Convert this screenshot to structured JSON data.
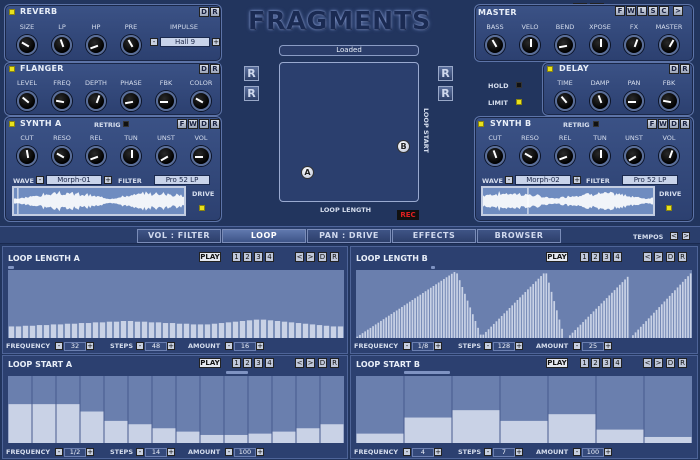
{
  "app": {
    "logo": "FRAGMENTS"
  },
  "header_buttons": {
    "d": "D",
    "r": "R",
    "f": "F",
    "w": "W",
    "l": "L",
    "s": "S",
    "c": "C",
    "next": ">"
  },
  "reverb": {
    "title": "REVERB",
    "labels": [
      "SIZE",
      "LP",
      "HP",
      "PRE",
      "IMPULSE"
    ],
    "impulse": "Hall 9"
  },
  "flanger": {
    "title": "FLANGER",
    "labels": [
      "LEVEL",
      "FREQ",
      "DEPTH",
      "PHASE",
      "FBK",
      "COLOR"
    ]
  },
  "synth_a": {
    "title": "SYNTH A",
    "retrig": "RETRIG",
    "labels": [
      "CUT",
      "RESO",
      "REL",
      "TUN",
      "UNST",
      "VOL"
    ],
    "wave_label": "WAVE",
    "wave": "Morph-01",
    "filter_label": "FILTER",
    "filter": "Pro 52 LP",
    "drive": "DRIVE"
  },
  "master": {
    "title": "MASTER",
    "labels": [
      "BASS",
      "VELO",
      "BEND",
      "XPOSE",
      "FX",
      "MASTER"
    ]
  },
  "delay": {
    "title": "DELAY",
    "labels": [
      "TIME",
      "DAMP",
      "PAN",
      "FBK"
    ]
  },
  "hold": "HOLD",
  "limit": "LIMIT",
  "synth_b": {
    "title": "SYNTH B",
    "retrig": "RETRIG",
    "labels": [
      "CUT",
      "RESO",
      "REL",
      "TUN",
      "UNST",
      "VOL"
    ],
    "wave_label": "WAVE",
    "wave": "Morph-02",
    "filter_label": "FILTER",
    "filter": "Pro 52 LP",
    "drive": "DRIVE"
  },
  "center": {
    "status": "Loaded",
    "loop_length": "LOOP LENGTH",
    "loop_start": "LOOP START",
    "ball_a": "A",
    "ball_b": "B",
    "rec": "REC"
  },
  "tabs": [
    "VOL : FILTER",
    "LOOP",
    "PAN : DRIVE",
    "EFFECTS",
    "BROWSER"
  ],
  "tempos": {
    "label": "TEMPOS",
    "prev": "<",
    "next": ">"
  },
  "loops": {
    "common": {
      "play": "PLAY",
      "nums": [
        "1",
        "2",
        "3",
        "4"
      ],
      "prev": "<",
      "next": ">",
      "d": "D",
      "r": "R",
      "freq": "FREQUENCY",
      "steps": "STEPS",
      "amount": "AMOUNT",
      "minus": "-",
      "plus": "+"
    },
    "length_a": {
      "title": "LOOP LENGTH A",
      "frequency": "32",
      "steps": "48",
      "amount": "16",
      "bars": [
        0.17,
        0.17,
        0.18,
        0.18,
        0.19,
        0.19,
        0.2,
        0.2,
        0.21,
        0.21,
        0.22,
        0.22,
        0.23,
        0.23,
        0.24,
        0.24,
        0.25,
        0.25,
        0.24,
        0.24,
        0.23,
        0.23,
        0.22,
        0.22,
        0.21,
        0.21,
        0.2,
        0.2,
        0.2,
        0.21,
        0.22,
        0.23,
        0.24,
        0.25,
        0.26,
        0.27,
        0.27,
        0.26,
        0.25,
        0.24,
        0.23,
        0.22,
        0.21,
        0.2,
        0.19,
        0.18,
        0.17,
        0.17
      ]
    },
    "length_b": {
      "title": "LOOP LENGTH B",
      "frequency": "1/8",
      "steps": "128",
      "amount": "25"
    },
    "start_a": {
      "title": "LOOP START A",
      "frequency": "1/2",
      "steps": "14",
      "amount": "100",
      "bars": [
        0.58,
        0.58,
        0.58,
        0.47,
        0.33,
        0.28,
        0.22,
        0.17,
        0.12,
        0.12,
        0.14,
        0.17,
        0.22,
        0.28
      ]
    },
    "start_b": {
      "title": "LOOP START B",
      "frequency": "4",
      "steps": "7",
      "amount": "100",
      "bars": [
        0.14,
        0.38,
        0.49,
        0.33,
        0.43,
        0.2,
        0.09
      ]
    }
  }
}
